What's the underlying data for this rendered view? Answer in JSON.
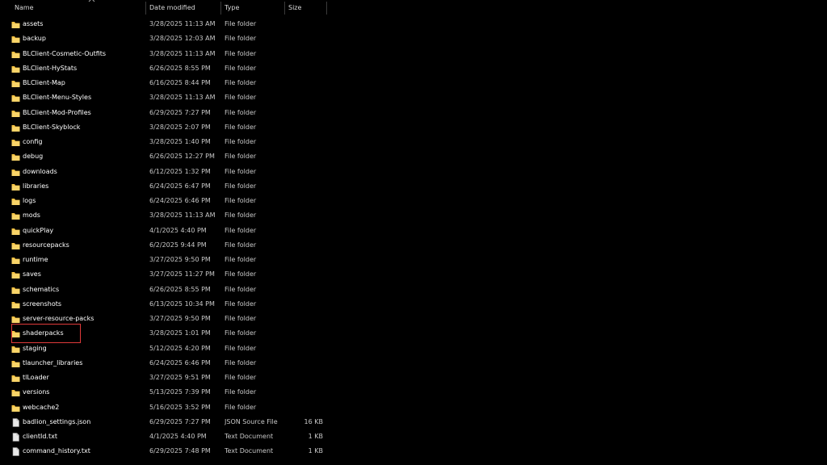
{
  "columns": {
    "name": "Name",
    "date": "Date modified",
    "type": "Type",
    "size": "Size"
  },
  "sort_indicator": "name-ascending",
  "highlighted_item": "shaderpacks",
  "colors": {
    "background": "#000000",
    "folder": "#f6c344",
    "highlight_box": "#e03a3a",
    "text": "#ffffff",
    "secondary_text": "#c8c8c8"
  },
  "items": [
    {
      "name": "assets",
      "date": "3/28/2025 11:13 AM",
      "type": "File folder",
      "size": "",
      "icon": "folder-icon"
    },
    {
      "name": "backup",
      "date": "3/28/2025 12:03 AM",
      "type": "File folder",
      "size": "",
      "icon": "folder-icon"
    },
    {
      "name": "BLClient-Cosmetic-Outfits",
      "date": "3/28/2025 11:13 AM",
      "type": "File folder",
      "size": "",
      "icon": "folder-icon"
    },
    {
      "name": "BLClient-HyStats",
      "date": "6/26/2025 8:55 PM",
      "type": "File folder",
      "size": "",
      "icon": "folder-icon"
    },
    {
      "name": "BLClient-Map",
      "date": "6/16/2025 8:44 PM",
      "type": "File folder",
      "size": "",
      "icon": "folder-icon"
    },
    {
      "name": "BLClient-Menu-Styles",
      "date": "3/28/2025 11:13 AM",
      "type": "File folder",
      "size": "",
      "icon": "folder-icon"
    },
    {
      "name": "BLClient-Mod-Profiles",
      "date": "6/29/2025 7:27 PM",
      "type": "File folder",
      "size": "",
      "icon": "folder-icon"
    },
    {
      "name": "BLClient-Skyblock",
      "date": "3/28/2025 2:07 PM",
      "type": "File folder",
      "size": "",
      "icon": "folder-icon"
    },
    {
      "name": "config",
      "date": "3/28/2025 1:40 PM",
      "type": "File folder",
      "size": "",
      "icon": "folder-icon"
    },
    {
      "name": "debug",
      "date": "6/26/2025 12:27 PM",
      "type": "File folder",
      "size": "",
      "icon": "folder-icon"
    },
    {
      "name": "downloads",
      "date": "6/12/2025 1:32 PM",
      "type": "File folder",
      "size": "",
      "icon": "folder-icon"
    },
    {
      "name": "libraries",
      "date": "6/24/2025 6:47 PM",
      "type": "File folder",
      "size": "",
      "icon": "folder-icon"
    },
    {
      "name": "logs",
      "date": "6/24/2025 6:46 PM",
      "type": "File folder",
      "size": "",
      "icon": "folder-icon"
    },
    {
      "name": "mods",
      "date": "3/28/2025 11:13 AM",
      "type": "File folder",
      "size": "",
      "icon": "folder-icon"
    },
    {
      "name": "quickPlay",
      "date": "4/1/2025 4:40 PM",
      "type": "File folder",
      "size": "",
      "icon": "folder-icon"
    },
    {
      "name": "resourcepacks",
      "date": "6/2/2025 9:44 PM",
      "type": "File folder",
      "size": "",
      "icon": "folder-icon"
    },
    {
      "name": "runtime",
      "date": "3/27/2025 9:50 PM",
      "type": "File folder",
      "size": "",
      "icon": "folder-icon"
    },
    {
      "name": "saves",
      "date": "3/27/2025 11:27 PM",
      "type": "File folder",
      "size": "",
      "icon": "folder-icon"
    },
    {
      "name": "schematics",
      "date": "6/26/2025 8:55 PM",
      "type": "File folder",
      "size": "",
      "icon": "folder-icon"
    },
    {
      "name": "screenshots",
      "date": "6/13/2025 10:34 PM",
      "type": "File folder",
      "size": "",
      "icon": "folder-icon"
    },
    {
      "name": "server-resource-packs",
      "date": "3/27/2025 9:50 PM",
      "type": "File folder",
      "size": "",
      "icon": "folder-icon"
    },
    {
      "name": "shaderpacks",
      "date": "3/28/2025 1:01 PM",
      "type": "File folder",
      "size": "",
      "icon": "folder-icon"
    },
    {
      "name": "staging",
      "date": "5/12/2025 4:20 PM",
      "type": "File folder",
      "size": "",
      "icon": "folder-icon"
    },
    {
      "name": "tlauncher_libraries",
      "date": "6/24/2025 6:46 PM",
      "type": "File folder",
      "size": "",
      "icon": "folder-icon"
    },
    {
      "name": "tlLoader",
      "date": "3/27/2025 9:51 PM",
      "type": "File folder",
      "size": "",
      "icon": "folder-icon"
    },
    {
      "name": "versions",
      "date": "5/13/2025 7:39 PM",
      "type": "File folder",
      "size": "",
      "icon": "folder-icon"
    },
    {
      "name": "webcache2",
      "date": "5/16/2025 3:52 PM",
      "type": "File folder",
      "size": "",
      "icon": "folder-icon"
    },
    {
      "name": "badlion_settings.json",
      "date": "6/29/2025 7:27 PM",
      "type": "JSON Source File",
      "size": "16 KB",
      "icon": "file-icon"
    },
    {
      "name": "clientId.txt",
      "date": "4/1/2025 4:40 PM",
      "type": "Text Document",
      "size": "1 KB",
      "icon": "file-icon"
    },
    {
      "name": "command_history.txt",
      "date": "6/29/2025 7:48 PM",
      "type": "Text Document",
      "size": "1 KB",
      "icon": "file-icon"
    }
  ]
}
